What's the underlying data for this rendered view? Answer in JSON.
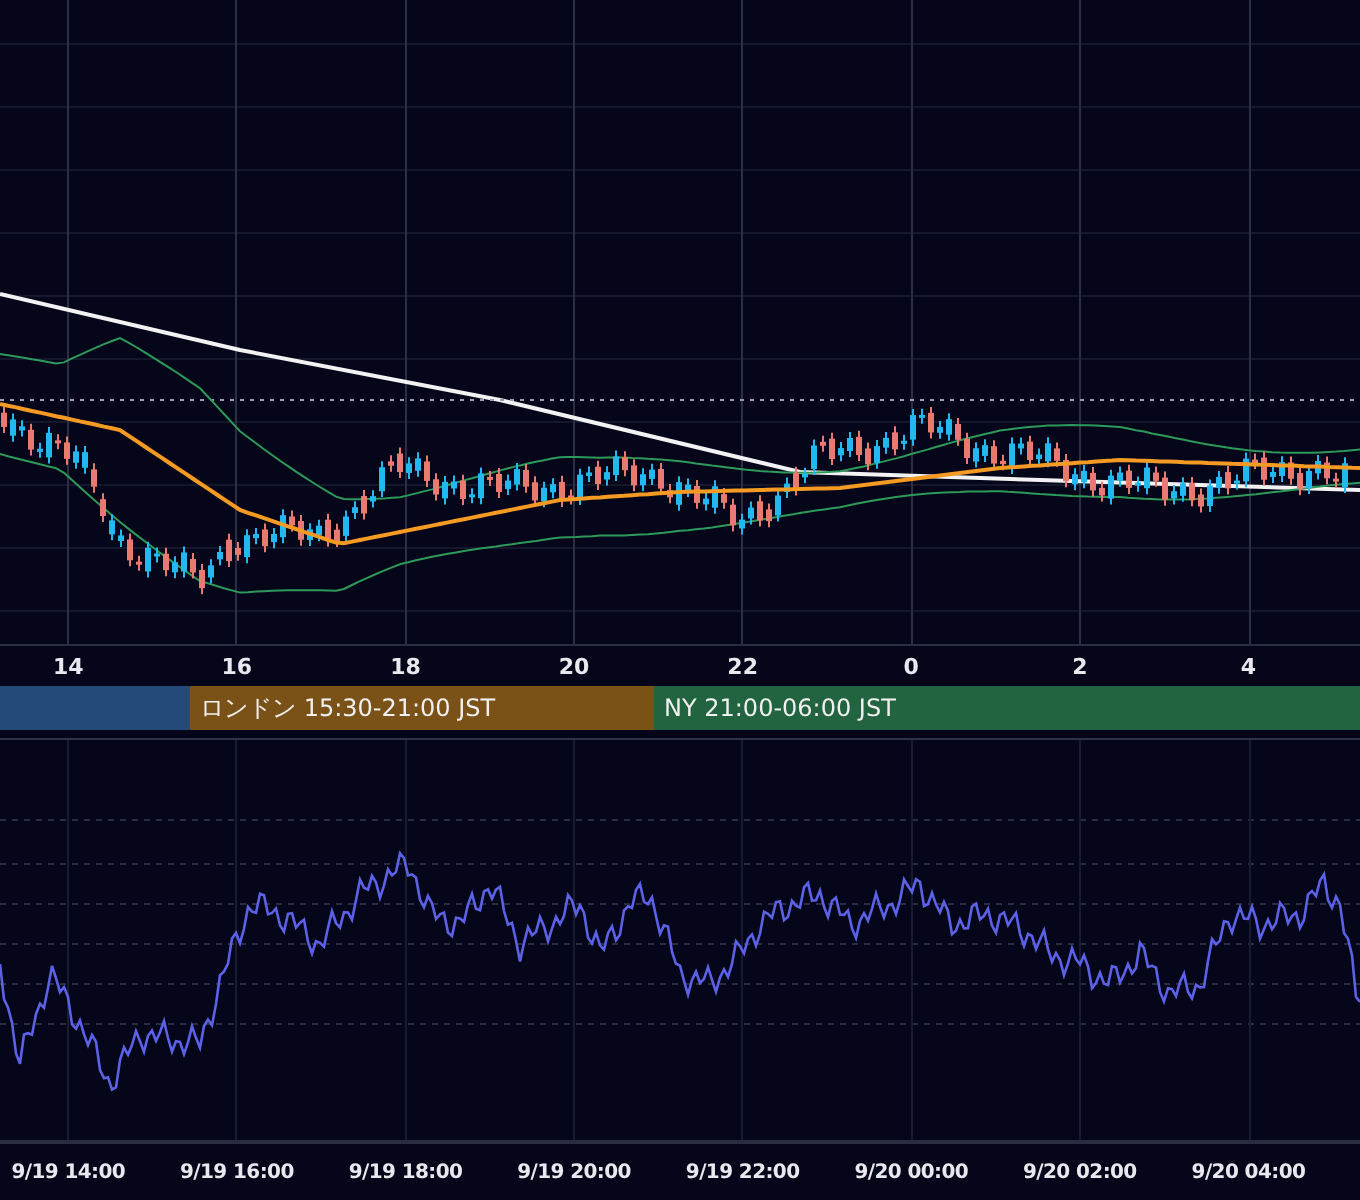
{
  "price_chart": {
    "x_axis_labels": [
      "14",
      "16",
      "18",
      "20",
      "22",
      "0",
      "2",
      "4"
    ]
  },
  "sessions": [
    {
      "color": "#234a78"
    },
    {
      "label": "ロンドン 15:30-21:00 JST",
      "color": "#7a5117"
    },
    {
      "label": "NY 21:00-06:00 JST",
      "color": "#226340"
    }
  ],
  "oscillator": {
    "time_labels": [
      "9/19 14:00",
      "9/19 16:00",
      "9/19 18:00",
      "9/19 20:00",
      "9/19 22:00",
      "9/20 00:00",
      "9/20 02:00",
      "9/20 04:00"
    ]
  }
}
